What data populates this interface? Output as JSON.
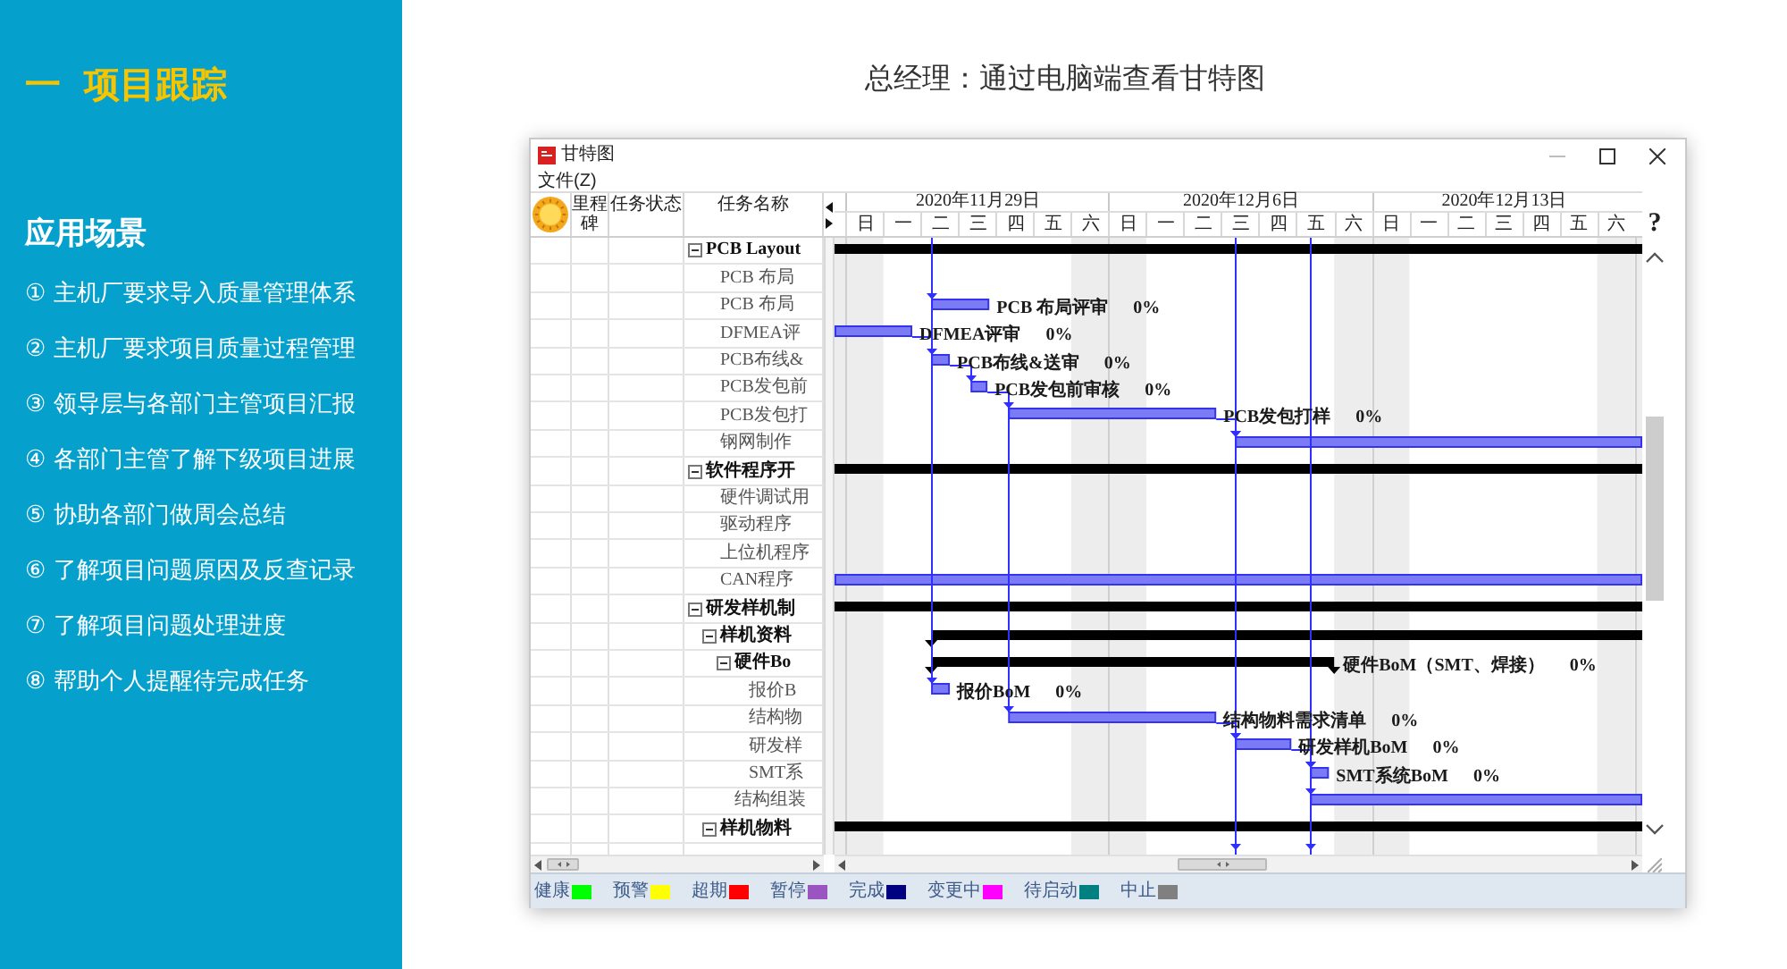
{
  "sidebar": {
    "title": "一 项目跟踪",
    "section_title": "应用场景",
    "items": [
      "① 主机厂要求导入质量管理体系",
      "② 主机厂要求项目质量过程管理",
      "③ 领导层与各部门主管项目汇报",
      "④ 各部门主管了解下级项目进展",
      "⑤ 协助各部门做周会总结",
      "⑥ 了解项目问题原因及反查记录",
      "⑦ 了解项目问题处理进度",
      "⑧ 帮助个人提醒待完成任务"
    ]
  },
  "heading": "总经理：通过电脑端查看甘特图",
  "window": {
    "title": "甘特图",
    "menu": [
      "文件(Z)"
    ],
    "help": "?"
  },
  "table": {
    "columns": [
      "里程碑",
      "任务状态",
      "任务名称"
    ]
  },
  "tasks": [
    {
      "name": "PCB Layout",
      "kind": "summary",
      "expanded": true,
      "children": [
        {
          "name": "PCB 布局",
          "kind": "plain"
        },
        {
          "name": "PCB 布局",
          "kind": "task",
          "bar_label": "PCB 布局评审",
          "progress": "0%"
        },
        {
          "name": "DFMEA评",
          "kind": "task",
          "bar_label": "DFMEA评审",
          "progress": "0%"
        },
        {
          "name": "PCB布线&",
          "kind": "task",
          "bar_label": "PCB布线&送审",
          "progress": "0%"
        },
        {
          "name": "PCB发包前",
          "kind": "task",
          "bar_label": "PCB发包前审核",
          "progress": "0%"
        },
        {
          "name": "PCB发包打",
          "kind": "task",
          "bar_label": "PCB发包打样",
          "progress": "0%"
        },
        {
          "name": "钢网制作",
          "kind": "task"
        }
      ]
    },
    {
      "name": "软件程序开",
      "kind": "summary",
      "expanded": true,
      "children": [
        {
          "name": "硬件调试用",
          "kind": "plain"
        },
        {
          "name": "驱动程序",
          "kind": "plain"
        },
        {
          "name": "上位机程序",
          "kind": "plain"
        },
        {
          "name": "CAN程序",
          "kind": "task"
        }
      ]
    },
    {
      "name": "研发样机制",
      "kind": "summary",
      "expanded": true,
      "children": [
        {
          "name": "样机资料",
          "kind": "summary",
          "expanded": true,
          "children": [
            {
              "name": "硬件Bo",
              "kind": "summary",
              "expanded": true,
              "bar_label": "硬件BoM（SMT、焊接）",
              "progress": "0%",
              "children": [
                {
                  "name": "报价B",
                  "kind": "task",
                  "bar_label": "报价BoM",
                  "progress": "0%"
                },
                {
                  "name": "结构物",
                  "kind": "task",
                  "bar_label": "结构物料需求清单",
                  "progress": "0%"
                },
                {
                  "name": "研发样",
                  "kind": "task",
                  "bar_label": "研发样机BoM",
                  "progress": "0%"
                },
                {
                  "name": "SMT系",
                  "kind": "task",
                  "bar_label": "SMT系统BoM",
                  "progress": "0%"
                }
              ]
            },
            {
              "name": "结构组装",
              "kind": "task"
            }
          ]
        },
        {
          "name": "样机物料",
          "kind": "summary",
          "expanded": true
        }
      ]
    }
  ],
  "timeline": {
    "weeks": [
      "2020年11月29日",
      "2020年12月6日",
      "2020年12月13日"
    ],
    "days": [
      "日",
      "一",
      "二",
      "三",
      "四",
      "五",
      "六",
      "日",
      "一",
      "二",
      "三",
      "四",
      "五",
      "六",
      "日",
      "一",
      "二",
      "三",
      "四",
      "五",
      "六"
    ]
  },
  "legend": [
    {
      "label": "健康",
      "color": "#00ff00"
    },
    {
      "label": "预警",
      "color": "#ffff00"
    },
    {
      "label": "超期",
      "color": "#ff0000"
    },
    {
      "label": "暂停",
      "color": "#9a55c0"
    },
    {
      "label": "完成",
      "color": "#000080"
    },
    {
      "label": "变更中",
      "color": "#ff00ff"
    },
    {
      "label": "待启动",
      "color": "#008080"
    },
    {
      "label": "中止",
      "color": "#808080"
    }
  ]
}
